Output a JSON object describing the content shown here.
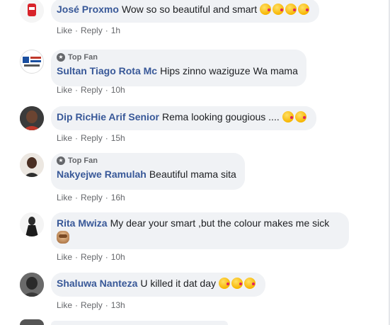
{
  "colors": {
    "author": "#385898",
    "bubble_bg": "#f0f2f5",
    "meta_text": "#65676b"
  },
  "comments": [
    {
      "author": "José Proxmo",
      "text": "Wow so so beautiful and smart",
      "emojis": [
        "kissing-face-emoji",
        "kissing-face-emoji",
        "kissing-face-emoji",
        "kissing-face-emoji"
      ],
      "like": "Like",
      "reply": "Reply",
      "time": "1h"
    },
    {
      "badge": "Top Fan",
      "author": "Sultan Tiago Rota Mc",
      "text": "Hips zinno waziguze Wa mama",
      "like": "Like",
      "reply": "Reply",
      "time": "10h"
    },
    {
      "author": "Dip RicHie Arif Senior",
      "text": "Rema looking gougious ....",
      "emojis": [
        "kissing-face-emoji",
        "kissing-face-emoji"
      ],
      "like": "Like",
      "reply": "Reply",
      "time": "15h"
    },
    {
      "badge": "Top Fan",
      "author": "Nakyejwe Ramulah",
      "text": "Beautiful mama sita",
      "like": "Like",
      "reply": "Reply",
      "time": "16h"
    },
    {
      "author": "Rita Mwiza",
      "text": "My dear your smart ,but the colour makes me sick",
      "emojis": [
        "see-no-evil-monkey-emoji"
      ],
      "like": "Like",
      "reply": "Reply",
      "time": "10h"
    },
    {
      "author": "Shaluwa Nanteza",
      "text": "U killed it dat day",
      "emojis": [
        "kissing-face-emoji",
        "kissing-face-emoji",
        "kissing-face-emoji"
      ],
      "like": "Like",
      "reply": "Reply",
      "time": "13h"
    }
  ]
}
